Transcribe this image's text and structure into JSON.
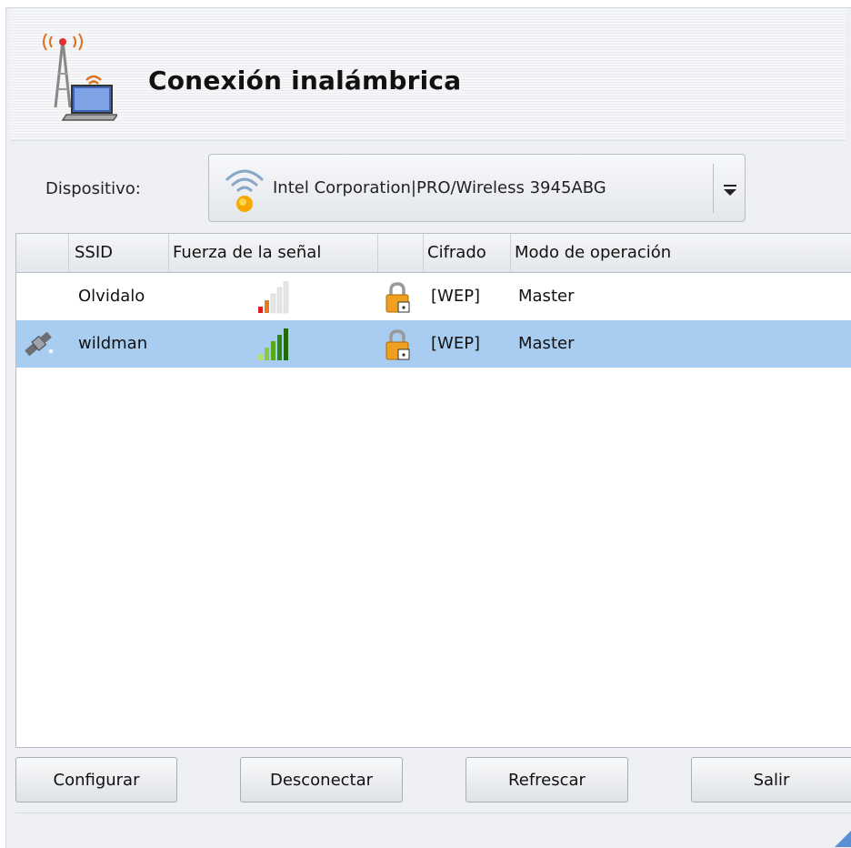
{
  "header": {
    "title": "Conexión inalámbrica",
    "icon": "wireless-laptop-icon"
  },
  "device": {
    "label": "Dispositivo:",
    "selected": "Intel Corporation|PRO/Wireless 3945ABG",
    "icon": "wireless-signal-icon"
  },
  "table": {
    "columns": [
      "",
      "SSID",
      "Fuerza de la señal",
      "",
      "Cifrado",
      "Modo de operación"
    ],
    "rows": [
      {
        "ssid": "Olvidalo",
        "signal_bars": 2,
        "signal_max": 5,
        "locked": true,
        "encryption": "[WEP]",
        "mode": "Master",
        "connected": false,
        "selected": false
      },
      {
        "ssid": "wildman",
        "signal_bars": 5,
        "signal_max": 5,
        "locked": true,
        "encryption": "[WEP]",
        "mode": "Master",
        "connected": true,
        "selected": true
      }
    ]
  },
  "buttons": {
    "configure": "Configurar",
    "disconnect": "Desconectar",
    "refresh": "Refrescar",
    "quit": "Salir"
  },
  "colors": {
    "selection": "#a8cdf0",
    "lock": "#f0a020",
    "signal_red": "#e02020",
    "signal_green": "#2a8a10"
  }
}
